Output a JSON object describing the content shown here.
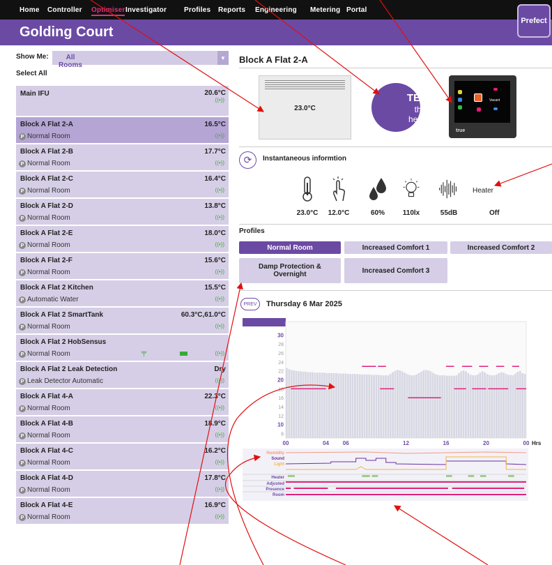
{
  "nav": {
    "items": [
      "Home",
      "Controller",
      "Optimiser",
      "Investigator",
      "Profiles",
      "Reports",
      "Engineering",
      "Metering",
      "Portal"
    ],
    "active": "Optimiser"
  },
  "site": {
    "title": "Golding Court",
    "logo": "Prefect"
  },
  "filter": {
    "label": "Show Me:",
    "value": "All Rooms",
    "select_all": "Select All"
  },
  "rooms": [
    {
      "name": "Main IFU",
      "temp": "20.6°C",
      "profile": "",
      "main": true
    },
    {
      "name": "Block A Flat 2-A",
      "temp": "16.5°C",
      "profile": "Normal Room",
      "selected": true
    },
    {
      "name": "Block A Flat 2-B",
      "temp": "17.7°C",
      "profile": "Normal Room"
    },
    {
      "name": "Block A Flat 2-C",
      "temp": "16.4°C",
      "profile": "Normal Room"
    },
    {
      "name": "Block A Flat 2-D",
      "temp": "13.8°C",
      "profile": "Normal Room"
    },
    {
      "name": "Block A Flat 2-E",
      "temp": "18.0°C",
      "profile": "Normal Room"
    },
    {
      "name": "Block A Flat 2-F",
      "temp": "15.6°C",
      "profile": "Normal Room"
    },
    {
      "name": "Block A Flat 2 Kitchen",
      "temp": "15.5°C",
      "profile": "Automatic Water"
    },
    {
      "name": "Block A Flat 2 SmartTank",
      "temp": "60.3°C,61.0°C",
      "profile": "Normal Room"
    },
    {
      "name": "Block A Flat 2 HobSensus",
      "temp": "",
      "profile": "Normal Room",
      "extras": true
    },
    {
      "name": "Block A Flat 2 Leak Detection",
      "temp": "Dry",
      "profile": "Leak Detector Automatic"
    },
    {
      "name": "Block A Flat 4-A",
      "temp": "22.3°C",
      "profile": "Normal Room"
    },
    {
      "name": "Block A Flat 4-B",
      "temp": "18.9°C",
      "profile": "Normal Room"
    },
    {
      "name": "Block A Flat 4-C",
      "temp": "16.2°C",
      "profile": "Normal Room"
    },
    {
      "name": "Block A Flat 4-D",
      "temp": "17.8°C",
      "profile": "Normal Room"
    },
    {
      "name": "Block A Flat 4-E",
      "temp": "16.9°C",
      "profile": "Normal Room"
    }
  ],
  "room_badge": "P",
  "signal_icon": "((•))",
  "detail": {
    "title": "Block A Flat 2-A",
    "heater_temp": "23.0°C",
    "test": {
      "a": "TEST",
      "b": "the",
      "c": "heater"
    },
    "device_brand": "true",
    "device_screen_label": "Vacant",
    "instant_label": "Instantaneous informtion",
    "readings": [
      {
        "icon": "thermometer-icon",
        "value": "23.0°C"
      },
      {
        "icon": "touch-icon",
        "value": "12.0°C"
      },
      {
        "icon": "humidity-icon",
        "value": "60%"
      },
      {
        "icon": "light-icon",
        "value": "110lx"
      },
      {
        "icon": "sound-icon",
        "value": "55dB"
      }
    ],
    "heater_label": "Heater",
    "heater_state": "Off"
  },
  "profiles": {
    "label": "Profiles",
    "buttons": [
      "Normal Room",
      "Increased Comfort 1",
      "Increased Comfort 2",
      "Damp Protection & Overnight",
      "Increased Comfort 3"
    ],
    "active": "Normal Room"
  },
  "day": {
    "prev": "PREV",
    "date": "Thursday 6 Mar 2025"
  },
  "chart_data": {
    "type": "bar",
    "y_ticks": [
      "30",
      "28",
      "26",
      "24",
      "22",
      "20",
      "18",
      "16",
      "14",
      "12",
      "10",
      "8"
    ],
    "ylim": [
      7,
      33
    ],
    "x_ticks": [
      "00",
      "04",
      "06",
      "12",
      "16",
      "20",
      "00"
    ],
    "x_unit": "Hrs",
    "temperature_profile": [
      22.6,
      22.4,
      22.2,
      22.1,
      22.0,
      21.9,
      21.9,
      21.8,
      21.8,
      21.7,
      21.7,
      21.7,
      21.6,
      21.6,
      21.6,
      21.6,
      21.6,
      21.5,
      21.5,
      21.5,
      21.5,
      21.5,
      21.4,
      21.4,
      21.4,
      21.4,
      21.3,
      21.3,
      21.3,
      21.3,
      21.3,
      21.2,
      21.2,
      21.2,
      21.2,
      21.2,
      21.1,
      21.1,
      21.1,
      21.1,
      21.0,
      21.0,
      21.0,
      21.0,
      21.3,
      21.7,
      22.0,
      22.2,
      22.1,
      21.9,
      21.6,
      21.3,
      21.1,
      21.0,
      21.0,
      21.2,
      21.5,
      21.8,
      22.1,
      22.2,
      22.1,
      21.9,
      21.6,
      21.3,
      21.1,
      21.0,
      21.0,
      21.0,
      20.9,
      20.9,
      20.9,
      20.9,
      21.0,
      21.5,
      21.9,
      22.1,
      21.9,
      21.5,
      21.1,
      21.0,
      21.0,
      21.2,
      21.6,
      21.9,
      21.7,
      21.3,
      21.1,
      21.0,
      21.0,
      21.2,
      21.5,
      21.7,
      21.6,
      21.3,
      21.1,
      21.1,
      21.0,
      21.4,
      21.8,
      22.0,
      21.5,
      21.3
    ],
    "setpoint_segments": [
      {
        "from": 0.5,
        "to": 4.0,
        "value": 18
      },
      {
        "from": 7.6,
        "to": 9.0,
        "value": 23
      },
      {
        "from": 9.2,
        "to": 10.0,
        "value": 23
      },
      {
        "from": 9.4,
        "to": 10.8,
        "value": 18
      },
      {
        "from": 12.2,
        "to": 15.5,
        "value": 16
      },
      {
        "from": 16.0,
        "to": 16.8,
        "value": 23
      },
      {
        "from": 17.6,
        "to": 18.6,
        "value": 23
      },
      {
        "from": 19.3,
        "to": 20.2,
        "value": 23
      },
      {
        "from": 21.0,
        "to": 21.8,
        "value": 23
      },
      {
        "from": 16.8,
        "to": 18.0,
        "value": 18
      },
      {
        "from": 18.6,
        "to": 20.0,
        "value": 18
      },
      {
        "from": 20.2,
        "to": 22.2,
        "value": 18
      },
      {
        "from": 22.6,
        "to": 23.3,
        "value": 23
      },
      {
        "from": 23.0,
        "to": 24.0,
        "value": 18
      }
    ],
    "series_labels": [
      "Humidity",
      "Sound",
      "Light",
      "Heater",
      "Adjusted",
      "Presence",
      "Room"
    ],
    "heater_on": [
      [
        0.2,
        0.9
      ],
      [
        7.6,
        8.4
      ],
      [
        8.6,
        9.2
      ],
      [
        16.0,
        16.6
      ],
      [
        18.2,
        18.8
      ],
      [
        19.4,
        20.0
      ],
      [
        22.2,
        22.8
      ]
    ],
    "presence_on": [
      [
        0.0,
        0.5
      ],
      [
        0.8,
        4.2
      ],
      [
        5.0,
        16.2
      ],
      [
        16.6,
        23.8
      ]
    ],
    "colors": {
      "bars": "#d8d8e4",
      "setpoint": "#e0207a",
      "header": "#6b4aa4",
      "humidity": "#f39a82",
      "sound": "#6b2fa0",
      "light": "#f5b342",
      "heater": "#9ccf8a",
      "adjusted": "#e0207a",
      "presence": "#e0207a",
      "room": "#e0207a"
    }
  }
}
